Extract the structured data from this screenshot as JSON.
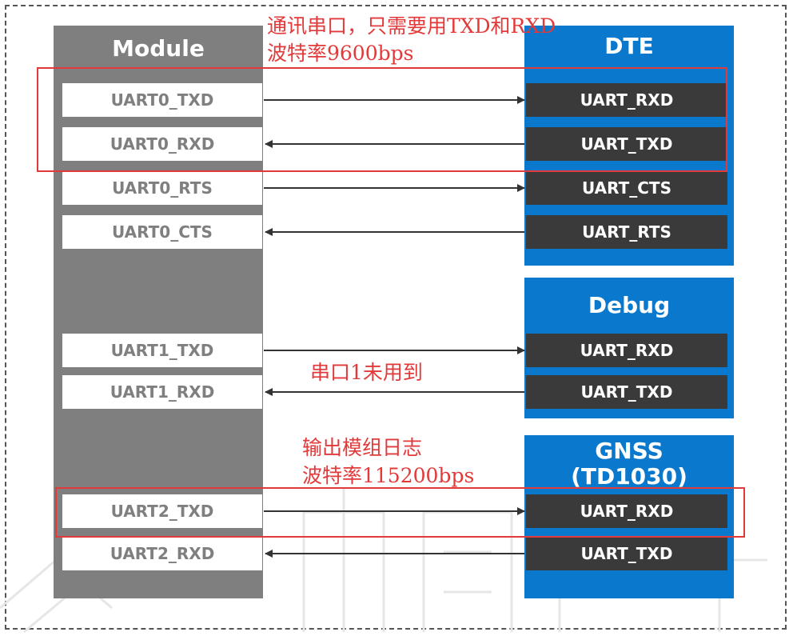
{
  "module": {
    "title": "Module",
    "pins": [
      "UART0_TXD",
      "UART0_RXD",
      "UART0_RTS",
      "UART0_CTS",
      "UART1_TXD",
      "UART1_RXD",
      "UART2_TXD",
      "UART2_RXD"
    ]
  },
  "dte": {
    "title": "DTE",
    "pins": [
      "UART_RXD",
      "UART_TXD",
      "UART_CTS",
      "UART_RTS"
    ]
  },
  "debug": {
    "title": "Debug",
    "pins": [
      "UART_RXD",
      "UART_TXD"
    ]
  },
  "gnss": {
    "title_line1": "GNSS",
    "title_line2": "(TD1030)",
    "pins": [
      "UART_RXD",
      "UART_TXD"
    ]
  },
  "annotations": {
    "uart0_line1": "通讯串口，只需要用TXD和RXD",
    "uart0_line2": "波特率9600bps",
    "uart1": "串口1未用到",
    "uart2_line1": "输出模组日志",
    "uart2_line2": "波特率115200bps"
  },
  "connections": [
    {
      "from": "UART0_TXD",
      "to": "DTE UART_RXD",
      "direction": "right"
    },
    {
      "from": "UART0_RXD",
      "to": "DTE UART_TXD",
      "direction": "left"
    },
    {
      "from": "UART0_RTS",
      "to": "DTE UART_CTS",
      "direction": "right"
    },
    {
      "from": "UART0_CTS",
      "to": "DTE UART_RTS",
      "direction": "left"
    },
    {
      "from": "UART1_TXD",
      "to": "Debug UART_RXD",
      "direction": "right"
    },
    {
      "from": "UART1_RXD",
      "to": "Debug UART_TXD",
      "direction": "left"
    },
    {
      "from": "UART2_TXD",
      "to": "GNSS UART_RXD",
      "direction": "right"
    },
    {
      "from": "UART2_RXD",
      "to": "GNSS UART_TXD",
      "direction": "left"
    }
  ],
  "colors": {
    "module_bg": "#7f7f7f",
    "device_bg": "#0a78cc",
    "device_pin_bg": "#3a3a3a",
    "annotation": "#e23a3a",
    "arrow": "#333333"
  }
}
